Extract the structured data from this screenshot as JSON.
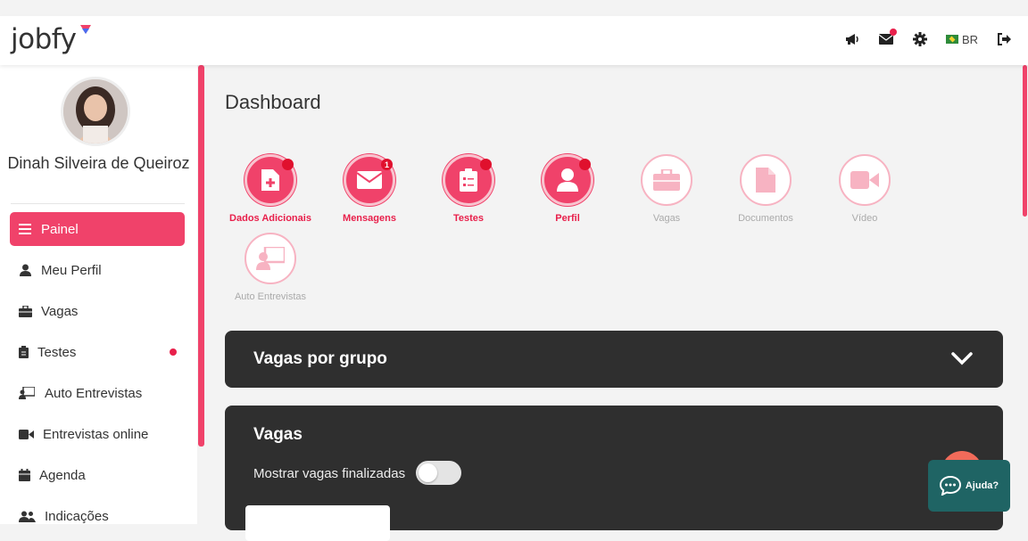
{
  "app": {
    "logo_text": "jobfy"
  },
  "header": {
    "lang_label": "BR",
    "icons": [
      "megaphone-icon",
      "envelope-icon",
      "gear-icon",
      "flag-icon",
      "logout-icon"
    ]
  },
  "sidebar": {
    "user_name": "Dinah Silveira de Queiroz",
    "items": [
      {
        "label": "Painel",
        "icon": "menu-icon",
        "active": true
      },
      {
        "label": "Meu Perfil",
        "icon": "user-icon"
      },
      {
        "label": "Vagas",
        "icon": "briefcase-icon"
      },
      {
        "label": "Testes",
        "icon": "clipboard-icon",
        "badge": true
      },
      {
        "label": "Auto Entrevistas",
        "icon": "presentation-icon"
      },
      {
        "label": "Entrevistas online",
        "icon": "video-icon"
      },
      {
        "label": "Agenda",
        "icon": "calendar-icon"
      },
      {
        "label": "Indicações",
        "icon": "users-icon"
      }
    ]
  },
  "main": {
    "title": "Dashboard",
    "shortcuts": [
      {
        "label": "Dados Adicionais",
        "icon": "file-plus-icon",
        "active": true,
        "badge": ""
      },
      {
        "label": "Mensagens",
        "icon": "envelope-icon",
        "active": true,
        "badge": "1"
      },
      {
        "label": "Testes",
        "icon": "clipboard-list-icon",
        "active": true,
        "badge": ""
      },
      {
        "label": "Perfil",
        "icon": "user-icon",
        "active": true,
        "badge": ""
      },
      {
        "label": "Vagas",
        "icon": "briefcase-icon",
        "active": false
      },
      {
        "label": "Documentos",
        "icon": "document-icon",
        "active": false
      },
      {
        "label": "Vídeo",
        "icon": "video-icon",
        "active": false
      },
      {
        "label": "Auto Entrevistas",
        "icon": "presentation-icon",
        "active": false
      }
    ],
    "groups_panel": {
      "title": "Vagas por grupo"
    },
    "jobs_panel": {
      "title": "Vagas",
      "toggle_label": "Mostrar vagas finalizadas",
      "toggle_on": false
    }
  },
  "help": {
    "label": "Ajuda?"
  },
  "colors": {
    "accent": "#f0426a",
    "dark_panel": "#2f2f2f",
    "help_bg": "#1f6464"
  }
}
